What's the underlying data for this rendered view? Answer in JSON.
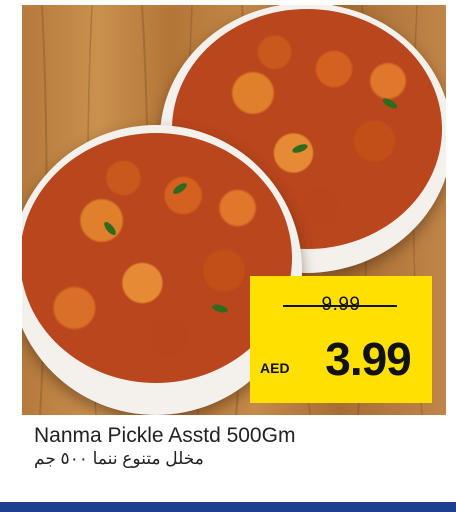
{
  "product": {
    "name_en": "Nanma Pickle Asstd 500Gm",
    "name_ar": "مخلل متنوع ننما ٥٠٠ جم"
  },
  "price": {
    "currency": "AED",
    "old": "9.99",
    "new": "3.99"
  },
  "colors": {
    "price_box": "#ffe000",
    "footer_bar": "#1d3f8f"
  }
}
